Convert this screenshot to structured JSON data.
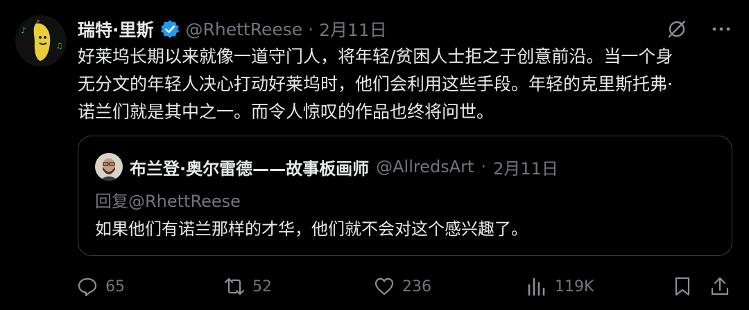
{
  "author": {
    "name": "瑞特·里斯",
    "handle": "@RhettReese",
    "separator": "·",
    "date": "2月11日"
  },
  "tweet": {
    "lines": [
      "好莱坞长期以来就像一道守门人，将年轻/贫困人士拒之于创意前沿。当一个身",
      "无分文的年轻人决心打动好莱坞时，他们会利用这些手段。年轻的克里斯托弗·",
      "诺兰们就是其中之一。而令人惊叹的作品也终将问世。"
    ]
  },
  "quote": {
    "name": "布兰登·奥尔雷德——故事板画师",
    "handle": "@AllredsArt",
    "separator": "·",
    "date": "2月11日",
    "reply_to": "回复@RhettReese",
    "text": "如果他们有诺兰那样的才华，他们就不会对这个感兴趣了。"
  },
  "actions": {
    "replies": "65",
    "retweets": "52",
    "likes": "236",
    "views": "119K"
  },
  "colors": {
    "background": "#000000",
    "text": "#e7e9ea",
    "muted": "#71767b",
    "verified": "#1d9bf0",
    "border": "#3a3f44"
  },
  "icons": [
    "banana-avatar",
    "verified-badge-icon",
    "grok-icon",
    "more-icon",
    "reply-icon",
    "retweet-icon",
    "like-icon",
    "views-icon",
    "bookmark-icon",
    "share-icon"
  ]
}
